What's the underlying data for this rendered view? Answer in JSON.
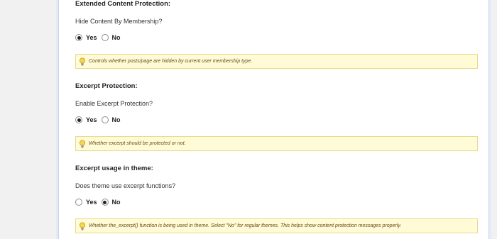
{
  "sections": [
    {
      "title": "Extended Content Protection:",
      "question": "Hide Content By Membership?",
      "yes_label": "Yes",
      "no_label": "No",
      "selected": "yes",
      "hint": "Controls whether posts/page are hidden by current user membership type."
    },
    {
      "title": "Excerpt Protection:",
      "question": "Enable Excerpt Protection?",
      "yes_label": "Yes",
      "no_label": "No",
      "selected": "yes",
      "hint": "Whether excerpt should be protected or not."
    },
    {
      "title": "Excerpt usage in theme:",
      "question": "Does theme use excerpt functions?",
      "yes_label": "Yes",
      "no_label": "No",
      "selected": "no",
      "hint": "Whether the_excerpt() function is being used in theme. Select \"No\" for regular themes. This helps show content protection messages properly."
    }
  ],
  "icons": {
    "hint_icon": "lightbulb-icon"
  }
}
